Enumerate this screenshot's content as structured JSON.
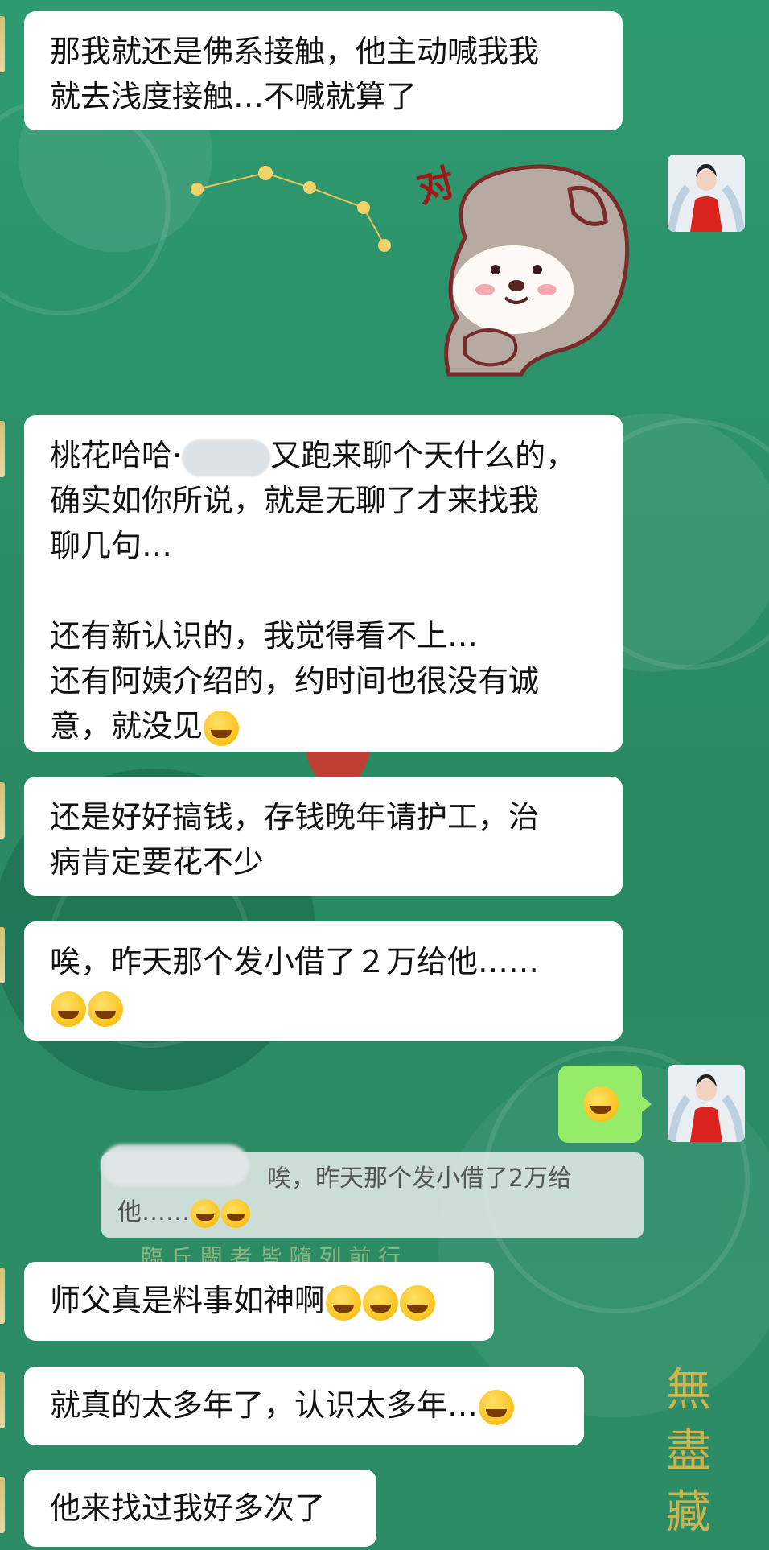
{
  "messages": {
    "m1": [
      "那我就还是佛系接触，他主动喊我我",
      "就去浅度接触…不喊就算了"
    ],
    "sticker_text": "对",
    "m2_line1_a": "桃花哈哈·",
    "m2_line1_b": "又跑来聊个天什么的，",
    "m2": [
      "确实如你所说，就是无聊了才来找我",
      "聊几句…"
    ],
    "m2b": [
      "还有新认识的，我觉得看不上…",
      "还有阿姨介绍的，约时间也很没有诚"
    ],
    "m2_last": "意，就没见",
    "m3": [
      "还是好好搞钱，存钱晚年请护工，治",
      "病肯定要花不少"
    ],
    "m4": "唉，昨天那个发小借了２万给他……",
    "quote_a": "唉，昨天那个发小借了2万给",
    "quote_b": "他……",
    "m5": "师父真是料事如神啊",
    "m6": "就真的太多年了，认识太多年…",
    "m7": "他来找过我好多次了"
  },
  "background_text": {
    "vertical_brand": [
      "無",
      "盡",
      "藏"
    ],
    "faint_line": "臨 丘 闕 者 皆 隨 列 前 行"
  },
  "colors": {
    "background": "#2f8f6a",
    "bubble_other": "#ffffff",
    "bubble_self": "#95ec69"
  },
  "icons": [
    "laugh-cry-emoji",
    "sticker-puppy",
    "avatar-red-dress"
  ]
}
